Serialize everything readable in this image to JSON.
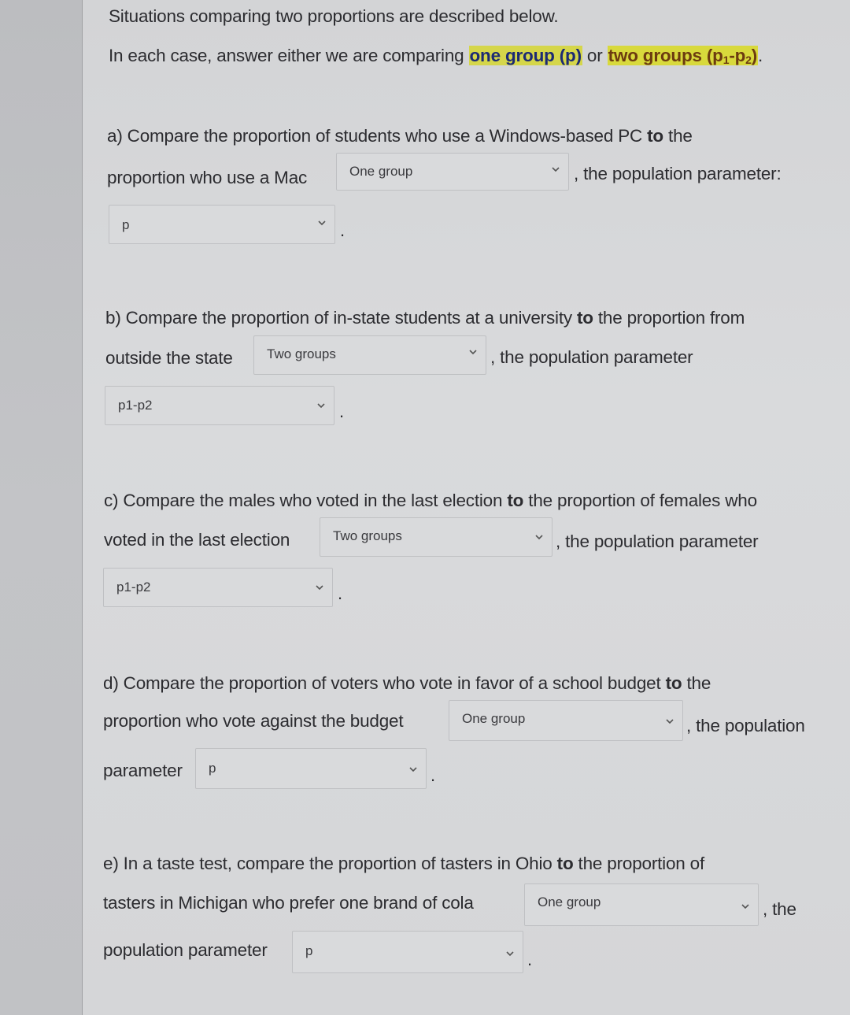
{
  "intro": {
    "line1": "Situations comparing two proportions are described below.",
    "line2_prefix": "In each case, answer either we are comparing ",
    "one_group": "one group (p)",
    "or": " or ",
    "two_groups_pre": "two groups (p",
    "sub1": "1",
    "dash": "-p",
    "sub2": "2",
    "close": ")",
    "period": ".",
    "highlight_colors": {
      "highlight": "#d5d64a",
      "one_group_text": "#1c2a74",
      "two_groups_text": "#6c3b10"
    }
  },
  "questions": [
    {
      "id": "a",
      "line1_pre": "a) Compare the proportion of students who use a Windows-based PC ",
      "to": "to",
      "line1_post": " the",
      "line2_pre": "proportion who use a Mac",
      "group_select": "One group",
      "line2_post": ", the population parameter:",
      "param_label": "",
      "param_select": "p",
      "end": "."
    },
    {
      "id": "b",
      "line1_pre": "b) Compare the proportion of in-state students at a university ",
      "to": "to",
      "line1_post": " the proportion from",
      "line2_pre": "outside the state",
      "group_select": "Two groups",
      "line2_post": ", the population parameter",
      "param_label": "",
      "param_select": "p1-p2",
      "end": "."
    },
    {
      "id": "c",
      "line1_pre": "c) Compare the males who voted in the last election ",
      "to": "to",
      "line1_post": " the proportion of females who",
      "line2_pre": "voted in the last election",
      "group_select": "Two groups",
      "line2_post": ", the population parameter",
      "param_label": "",
      "param_select": "p1-p2",
      "end": "."
    },
    {
      "id": "d",
      "line1_pre": "d) Compare the proportion of voters who vote in favor of a school budget ",
      "to": "to",
      "line1_post": " the",
      "line2_pre": "proportion who vote against the budget",
      "group_select": "One group",
      "line2_post": ", the population",
      "param_label": "parameter",
      "param_select": "p",
      "end": "."
    },
    {
      "id": "e",
      "line1_pre": "e) In a taste test, compare the proportion of tasters in Ohio ",
      "to": "to",
      "line1_post": " the proportion of",
      "line2_pre": "tasters in Michigan who prefer one brand of cola",
      "group_select": "One group",
      "line2_post": ", the",
      "param_label": "population parameter",
      "param_select": "p",
      "end": "."
    }
  ],
  "icons": {
    "dropdown": "chevron-down-icon"
  }
}
